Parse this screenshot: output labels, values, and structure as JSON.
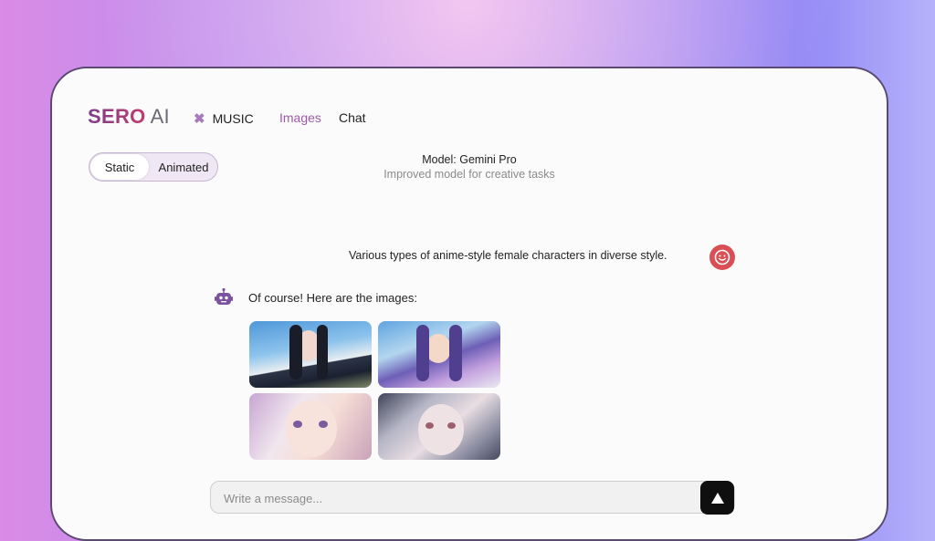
{
  "brand": {
    "part1": "SERO",
    "part2": "AI"
  },
  "nav": {
    "music_label": "MUSIC",
    "music_icon": "puzzle-icon",
    "images_label": "Images",
    "chat_label": "Chat",
    "active_color": "#9d5aa8"
  },
  "mode_toggle": {
    "options": [
      "Static",
      "Animated"
    ],
    "selected": "Static"
  },
  "model": {
    "title": "Model: Gemini Pro",
    "subtitle": "Improved model for creative tasks"
  },
  "conversation": {
    "user_message": "Various types of anime-style female characters in diverse style.",
    "bot_message": "Of course! Here are the images:",
    "user_avatar_color": "#d94f55",
    "bot_icon": "robot-icon",
    "images_count": 4
  },
  "composer": {
    "placeholder": "Write a message...",
    "value": "",
    "send_icon": "arrow-up-icon"
  }
}
